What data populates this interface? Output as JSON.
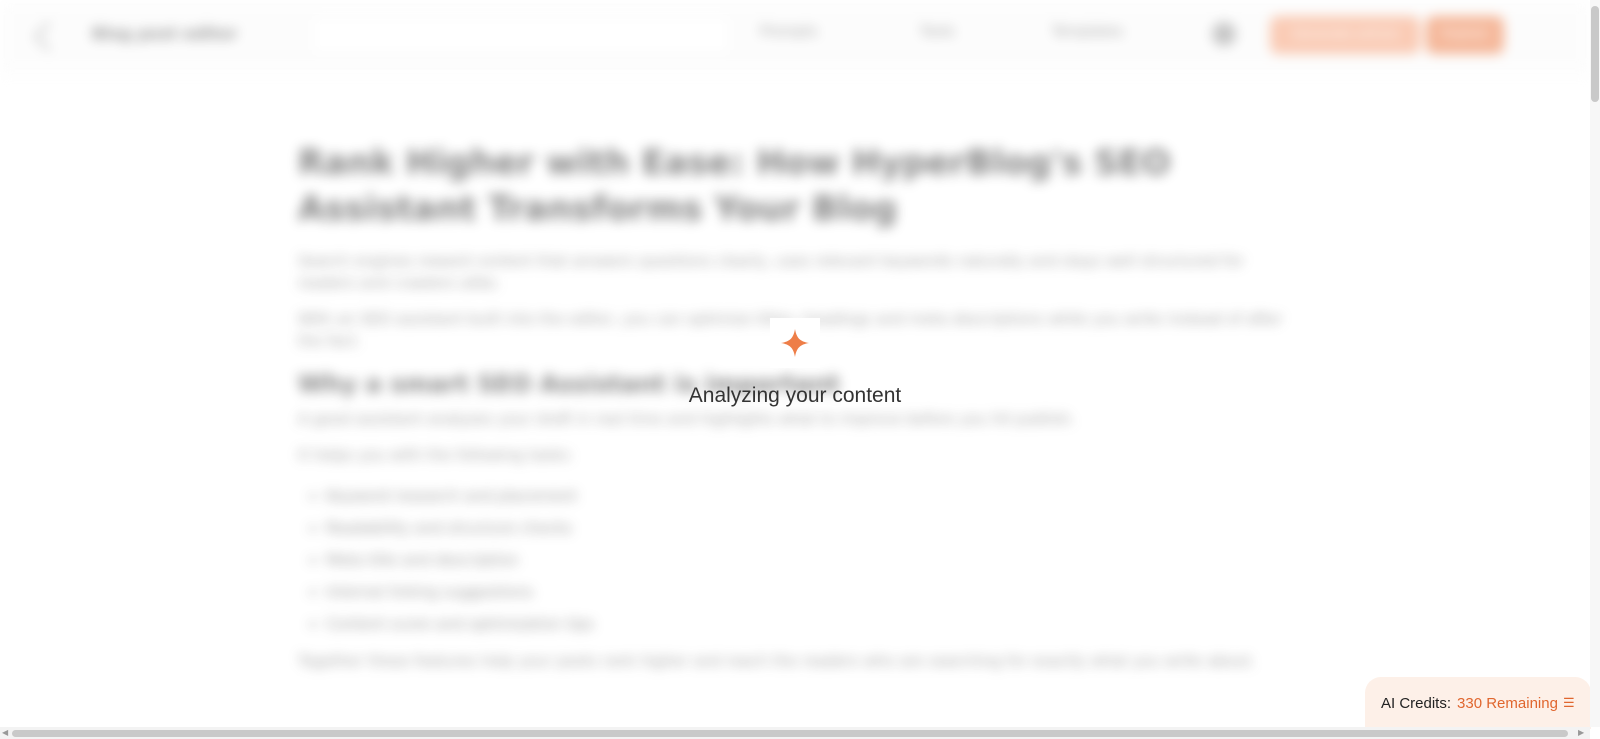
{
  "header": {
    "title": "Blog post editor",
    "menu": [
      "Prompts",
      "Tools",
      "Templates"
    ],
    "cta_primary": "Generate article",
    "cta_secondary": "Publish"
  },
  "article": {
    "title": "Rank Higher with Ease: How HyperBlog's SEO Assistant Transforms Your Blog",
    "intro": "Search engines reward content that answers questions clearly, uses relevant keywords naturally and stays well structured for readers and crawlers alike.",
    "intro2": "With an SEO assistant built into the editor, you can optimize titles, headings and meta descriptions while you write instead of after the fact.",
    "section_heading": "Why a smart SEO Assistant is important",
    "section_body": "A good assistant analyzes your draft in real time and highlights what to improve before you hit publish.",
    "list_intro": "It helps you with the following tasks:",
    "list": [
      "Keyword research and placement",
      "Readability and structure checks",
      "Meta title and description",
      "Internal linking suggestions",
      "Content score and optimization tips"
    ],
    "closing": "Together these features help your posts rank higher and reach the readers who are searching for exactly what you write about."
  },
  "overlay": {
    "status_text": "Analyzing your content",
    "icon": "sparkle-icon",
    "accent": "#ee7e48"
  },
  "credits": {
    "label": "AI Credits:",
    "remaining": "330 Remaining",
    "icon": "coins-icon"
  }
}
